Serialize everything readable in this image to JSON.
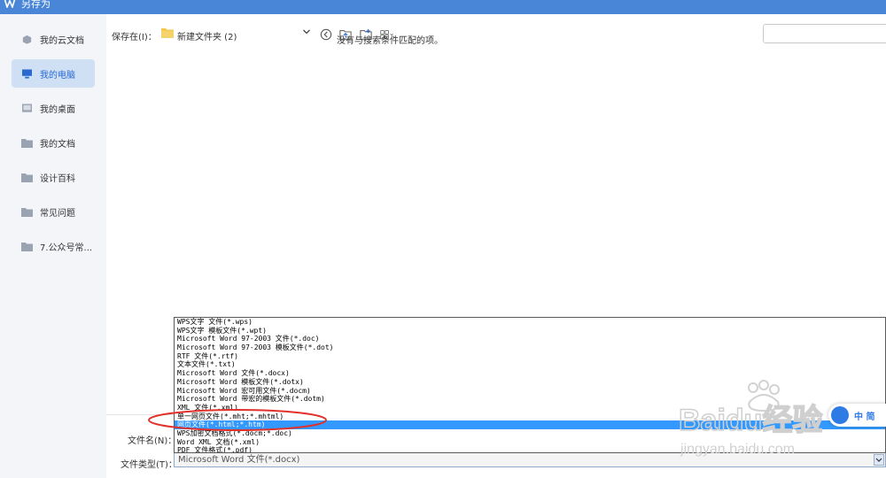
{
  "window": {
    "title": "另存为"
  },
  "sidebar": {
    "items": [
      {
        "label": "我的云文档",
        "icon": "cloud-doc-icon",
        "active": false
      },
      {
        "label": "我的电脑",
        "icon": "computer-icon",
        "active": true
      },
      {
        "label": "我的桌面",
        "icon": "desktop-icon",
        "active": false
      },
      {
        "label": "我的文档",
        "icon": "folder-icon",
        "active": false
      },
      {
        "label": "设计百科",
        "icon": "folder-icon",
        "active": false
      },
      {
        "label": "常见问题",
        "icon": "folder-icon",
        "active": false
      },
      {
        "label": "7.公众号常...",
        "icon": "folder-icon",
        "active": false
      }
    ]
  },
  "toolbar": {
    "save_in_label": "保存在(I)：",
    "current_path": "新建文件夹 (2)",
    "icons": [
      "back-icon",
      "up-folder-icon",
      "new-folder-icon",
      "view-mode-icon"
    ]
  },
  "file_list": {
    "empty_message": "没有与搜索条件匹配的项。"
  },
  "form": {
    "filename_label": "文件名(N)：",
    "filetype_label": "文件类型(T)：",
    "filetype_value": "Microsoft Word 文件(*.docx)"
  },
  "filetype_options": [
    "WPS文字 文件(*.wps)",
    "WPS文字 模板文件(*.wpt)",
    "Microsoft Word 97-2003 文件(*.doc)",
    "Microsoft Word 97-2003 模板文件(*.dot)",
    "RTF 文件(*.rtf)",
    "文本文件(*.txt)",
    "Microsoft Word 文件(*.docx)",
    "Microsoft Word 模板文件(*.dotx)",
    "Microsoft Word 宏可用文件(*.docm)",
    "Microsoft Word 带宏的模板文件(*.dotm)",
    "XML 文件(*.xml)",
    "单一网页文件(*.mht;*.mhtml)",
    "网页文件(*.html;*.htm)",
    "WPS加密文档格式(*.docm;*.doc)",
    "Word XML 文档(*.xml)",
    "PDF 文件格式(*.pdf)"
  ],
  "selected_option_index": 12,
  "watermark": {
    "text": "Baidu经验",
    "url": "jingyan.baidu.com",
    "badge": "中 简"
  },
  "colors": {
    "titlebar": "#4a86d8",
    "accent": "#3399ff",
    "annotation": "#e0312b"
  }
}
